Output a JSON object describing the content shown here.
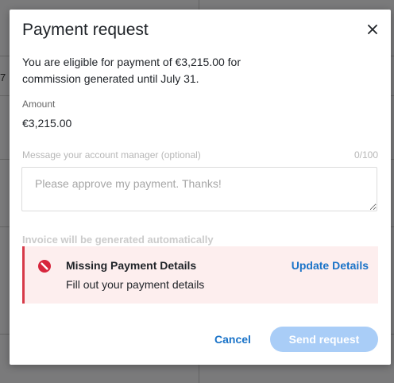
{
  "background": {
    "cell_text": "7"
  },
  "modal": {
    "title": "Payment request",
    "intro_text": "You are eligible for payment of €3,215.00 for commission generated until July 31.",
    "amount_label": "Amount",
    "amount_value": "€3,215.00",
    "message_label": "Message your account manager (optional)",
    "message_count": "0/100",
    "message_placeholder": "Please approve my payment. Thanks!",
    "message_value": "",
    "invoice_note": "Invoice will be generated automatically",
    "alert": {
      "title": "Missing Payment Details",
      "text": "Fill out your payment details",
      "action_label": "Update Details",
      "icon": "no-entry-icon",
      "color": "#d73a49"
    },
    "cancel_label": "Cancel",
    "send_label": "Send request"
  },
  "colors": {
    "accent": "#1a73c8",
    "disabled_button": "#a9cdf7",
    "alert_bg": "#fdeeee"
  }
}
